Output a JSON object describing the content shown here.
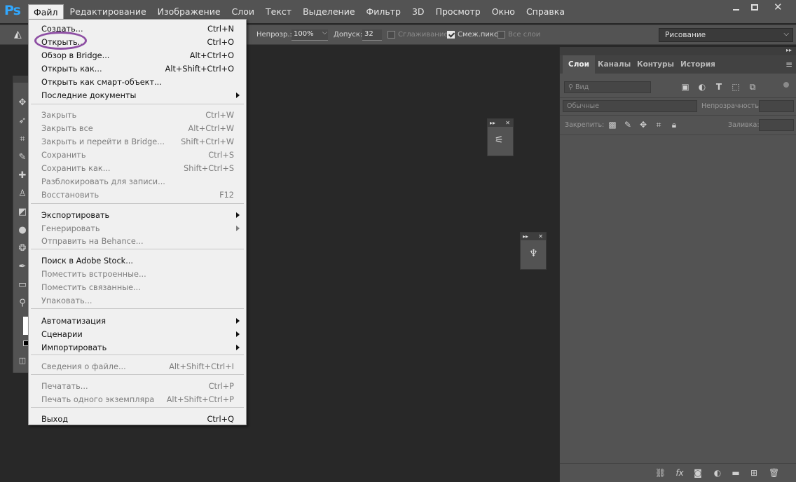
{
  "app": {
    "logo": "Ps"
  },
  "menubar": {
    "items": [
      "Файл",
      "Редактирование",
      "Изображение",
      "Слои",
      "Текст",
      "Выделение",
      "Фильтр",
      "3D",
      "Просмотр",
      "Окно",
      "Справка"
    ],
    "active_index": 0
  },
  "options_bar": {
    "opacity_label": "Непрозр.:",
    "opacity_value": "100%",
    "tolerance_label": "Допуск:",
    "tolerance_value": "32",
    "antialias_label": "Сглаживание",
    "contiguous_label": "Смеж.пикс",
    "all_layers_label": "Все слои",
    "workspace": "Рисование"
  },
  "file_menu": {
    "items": [
      {
        "label": "Создать...",
        "shortcut": "Ctrl+N",
        "enabled": true
      },
      {
        "label": "Открыть...",
        "shortcut": "Ctrl+O",
        "enabled": true
      },
      {
        "label": "Обзор в Bridge...",
        "shortcut": "Alt+Ctrl+O",
        "enabled": true
      },
      {
        "label": "Открыть как...",
        "shortcut": "Alt+Shift+Ctrl+O",
        "enabled": true
      },
      {
        "label": "Открыть как смарт-объект...",
        "shortcut": "",
        "enabled": true
      },
      {
        "label": "Последние документы",
        "shortcut": "",
        "enabled": true,
        "submenu": true
      },
      {
        "label": "Закрыть",
        "shortcut": "Ctrl+W",
        "enabled": false
      },
      {
        "label": "Закрыть все",
        "shortcut": "Alt+Ctrl+W",
        "enabled": false
      },
      {
        "label": "Закрыть и перейти в Bridge...",
        "shortcut": "Shift+Ctrl+W",
        "enabled": false
      },
      {
        "label": "Сохранить",
        "shortcut": "Ctrl+S",
        "enabled": false
      },
      {
        "label": "Сохранить как...",
        "shortcut": "Shift+Ctrl+S",
        "enabled": false
      },
      {
        "label": "Разблокировать для записи...",
        "shortcut": "",
        "enabled": false
      },
      {
        "label": "Восстановить",
        "shortcut": "F12",
        "enabled": false
      },
      {
        "label": "Экспортировать",
        "shortcut": "",
        "enabled": true,
        "submenu": true
      },
      {
        "label": "Генерировать",
        "shortcut": "",
        "enabled": false,
        "submenu": true
      },
      {
        "label": "Отправить на Behance...",
        "shortcut": "",
        "enabled": false
      },
      {
        "label": "Поиск в Adobe Stock...",
        "shortcut": "",
        "enabled": true
      },
      {
        "label": "Поместить встроенные...",
        "shortcut": "",
        "enabled": false
      },
      {
        "label": "Поместить связанные...",
        "shortcut": "",
        "enabled": false
      },
      {
        "label": "Упаковать...",
        "shortcut": "",
        "enabled": false
      },
      {
        "label": "Автоматизация",
        "shortcut": "",
        "enabled": true,
        "submenu": true
      },
      {
        "label": "Сценарии",
        "shortcut": "",
        "enabled": true,
        "submenu": true
      },
      {
        "label": "Импортировать",
        "shortcut": "",
        "enabled": true,
        "submenu": true
      },
      {
        "label": "Сведения о файле...",
        "shortcut": "Alt+Shift+Ctrl+I",
        "enabled": false
      },
      {
        "label": "Печатать...",
        "shortcut": "Ctrl+P",
        "enabled": false
      },
      {
        "label": "Печать одного экземпляра",
        "shortcut": "Alt+Shift+Ctrl+P",
        "enabled": false
      },
      {
        "label": "Выход",
        "shortcut": "Ctrl+Q",
        "enabled": true
      }
    ],
    "highlighted_item": "Открыть..."
  },
  "layers_panel": {
    "tabs": [
      "Слои",
      "Каналы",
      "Контуры",
      "История"
    ],
    "active_tab": 0,
    "search_placeholder": "Вид",
    "blend_mode": "Обычные",
    "opacity_label": "Непрозрачность:",
    "lock_label": "Закрепить:",
    "fill_label": "Заливка:"
  },
  "colors": {
    "accent": "#31a8ff",
    "highlight_ellipse": "#8e4fa4",
    "menu_bg": "#f0f0f0",
    "chrome": "#535353",
    "canvas": "#282828"
  }
}
